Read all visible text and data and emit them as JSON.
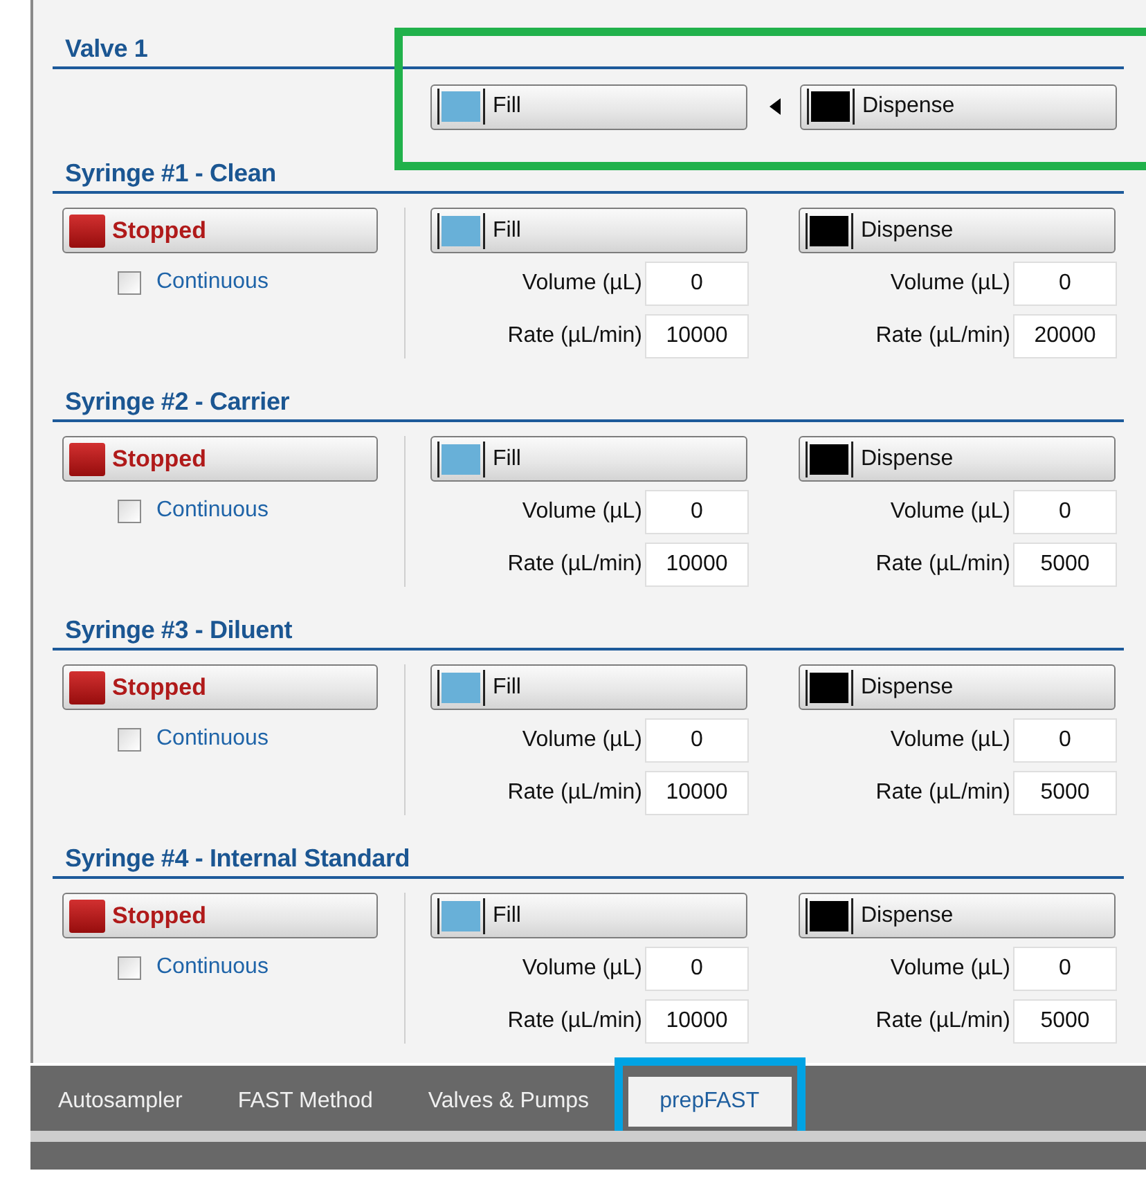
{
  "valve": {
    "title": "Valve 1",
    "outlined": true,
    "buttons": [
      {
        "kind": "fill",
        "label": "Fill"
      },
      {
        "kind": "dispense",
        "label": "Dispense"
      }
    ]
  },
  "syringes": [
    {
      "title": "Syringe #1  - Clean",
      "status": "Stopped",
      "continuous": {
        "label": "Continuous",
        "checked": false
      },
      "actions": [
        {
          "kind": "fill",
          "label": "Fill",
          "volume_label": "Volume (µL)",
          "volume": "0",
          "rate_label": "Rate (µL/min)",
          "rate": "10000"
        },
        {
          "kind": "dispense",
          "label": "Dispense",
          "volume_label": "Volume (µL)",
          "volume": "0",
          "rate_label": "Rate (µL/min)",
          "rate": "20000"
        }
      ]
    },
    {
      "title": "Syringe #2  - Carrier",
      "status": "Stopped",
      "continuous": {
        "label": "Continuous",
        "checked": false
      },
      "actions": [
        {
          "kind": "fill",
          "label": "Fill",
          "volume_label": "Volume (µL)",
          "volume": "0",
          "rate_label": "Rate (µL/min)",
          "rate": "10000"
        },
        {
          "kind": "dispense",
          "label": "Dispense",
          "volume_label": "Volume (µL)",
          "volume": "0",
          "rate_label": "Rate (µL/min)",
          "rate": "5000"
        }
      ]
    },
    {
      "title": "Syringe #3  - Diluent",
      "status": "Stopped",
      "continuous": {
        "label": "Continuous",
        "checked": false
      },
      "actions": [
        {
          "kind": "fill",
          "label": "Fill",
          "volume_label": "Volume (µL)",
          "volume": "0",
          "rate_label": "Rate (µL/min)",
          "rate": "10000"
        },
        {
          "kind": "dispense",
          "label": "Dispense",
          "volume_label": "Volume (µL)",
          "volume": "0",
          "rate_label": "Rate (µL/min)",
          "rate": "5000"
        }
      ]
    },
    {
      "title": "Syringe #4  - Internal Standard",
      "status": "Stopped",
      "continuous": {
        "label": "Continuous",
        "checked": false
      },
      "actions": [
        {
          "kind": "fill",
          "label": "Fill",
          "volume_label": "Volume (µL)",
          "volume": "0",
          "rate_label": "Rate (µL/min)",
          "rate": "10000"
        },
        {
          "kind": "dispense",
          "label": "Dispense",
          "volume_label": "Volume (µL)",
          "volume": "0",
          "rate_label": "Rate (µL/min)",
          "rate": "5000"
        }
      ]
    }
  ],
  "tabs": [
    {
      "label": "Autosampler",
      "selected": false,
      "outlined": false
    },
    {
      "label": "FAST Method",
      "selected": false,
      "outlined": false
    },
    {
      "label": "Valves & Pumps",
      "selected": false,
      "outlined": false
    },
    {
      "label": "prepFAST",
      "selected": true,
      "outlined": true
    }
  ]
}
